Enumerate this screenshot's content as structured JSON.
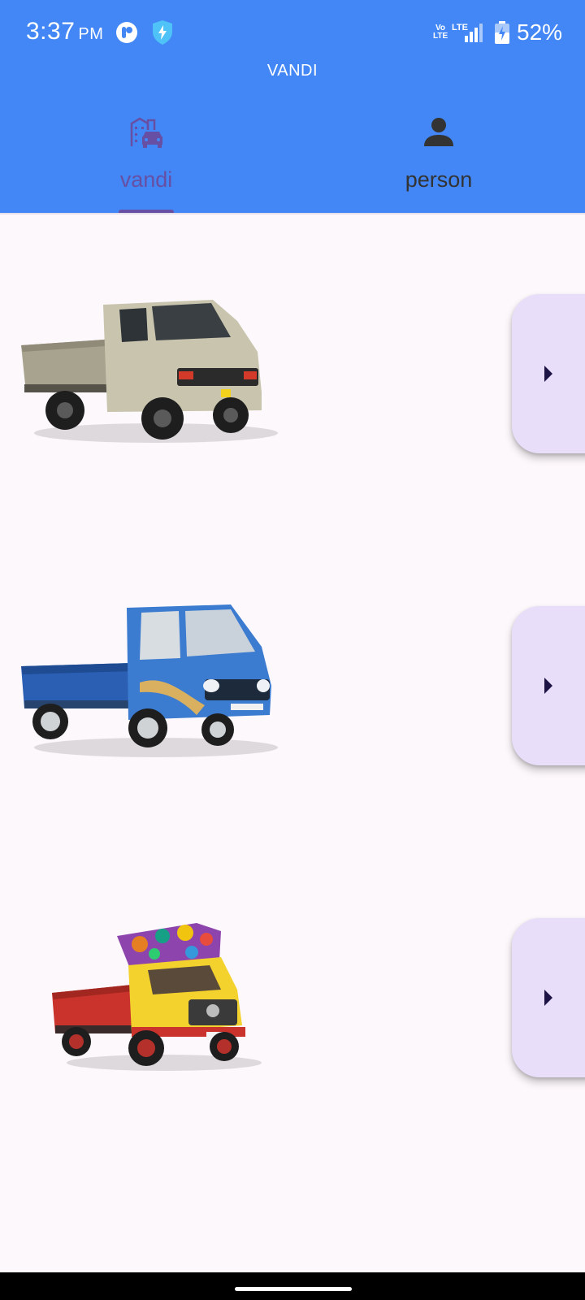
{
  "status_bar": {
    "time": "3:37",
    "ampm": "PM",
    "volte": "Vo LTE",
    "network": "LTE",
    "battery": "52%"
  },
  "app": {
    "title": "VANDI"
  },
  "tabs": [
    {
      "label": "vandi",
      "icon": "city-car-icon",
      "selected": true
    },
    {
      "label": "person",
      "icon": "person-icon",
      "selected": false
    }
  ],
  "vehicles": [
    {
      "name": "beige-pickup-truck",
      "color": "#bdb8a0"
    },
    {
      "name": "blue-mini-truck",
      "color": "#2f6fc4"
    },
    {
      "name": "decorated-red-yellow-truck",
      "color": "#e23b2e"
    }
  ],
  "colors": {
    "primary_bar": "#4287f5",
    "tab_selected": "#6750a4",
    "button_bg": "#e8defa",
    "background": "#fdf8fc"
  }
}
